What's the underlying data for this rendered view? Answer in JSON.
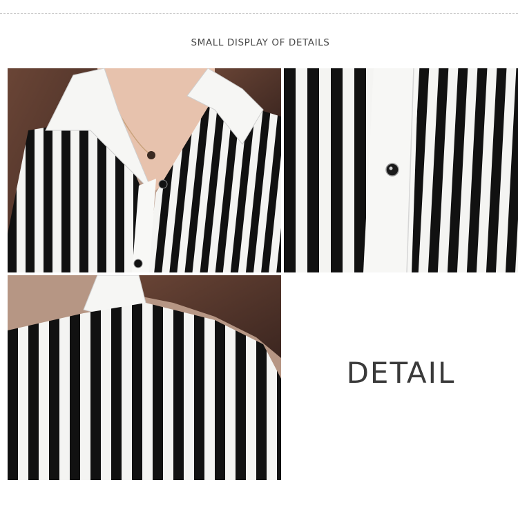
{
  "header": {
    "title": "SMALL DISPLAY OF DETAILS"
  },
  "photos": [
    {
      "subject": "collar-front-closeup"
    },
    {
      "subject": "button-placket-closeup"
    },
    {
      "subject": "back-shoulder-closeup"
    }
  ],
  "detail_panel": {
    "label": "DETAIL"
  },
  "colors": {
    "stripe_black": "#111111",
    "stripe_white": "#f4f4f2",
    "hair": "#4a3128",
    "skin": "#e7c2ad",
    "text": "#3a3a3a",
    "rule": "#c9c9c9"
  }
}
